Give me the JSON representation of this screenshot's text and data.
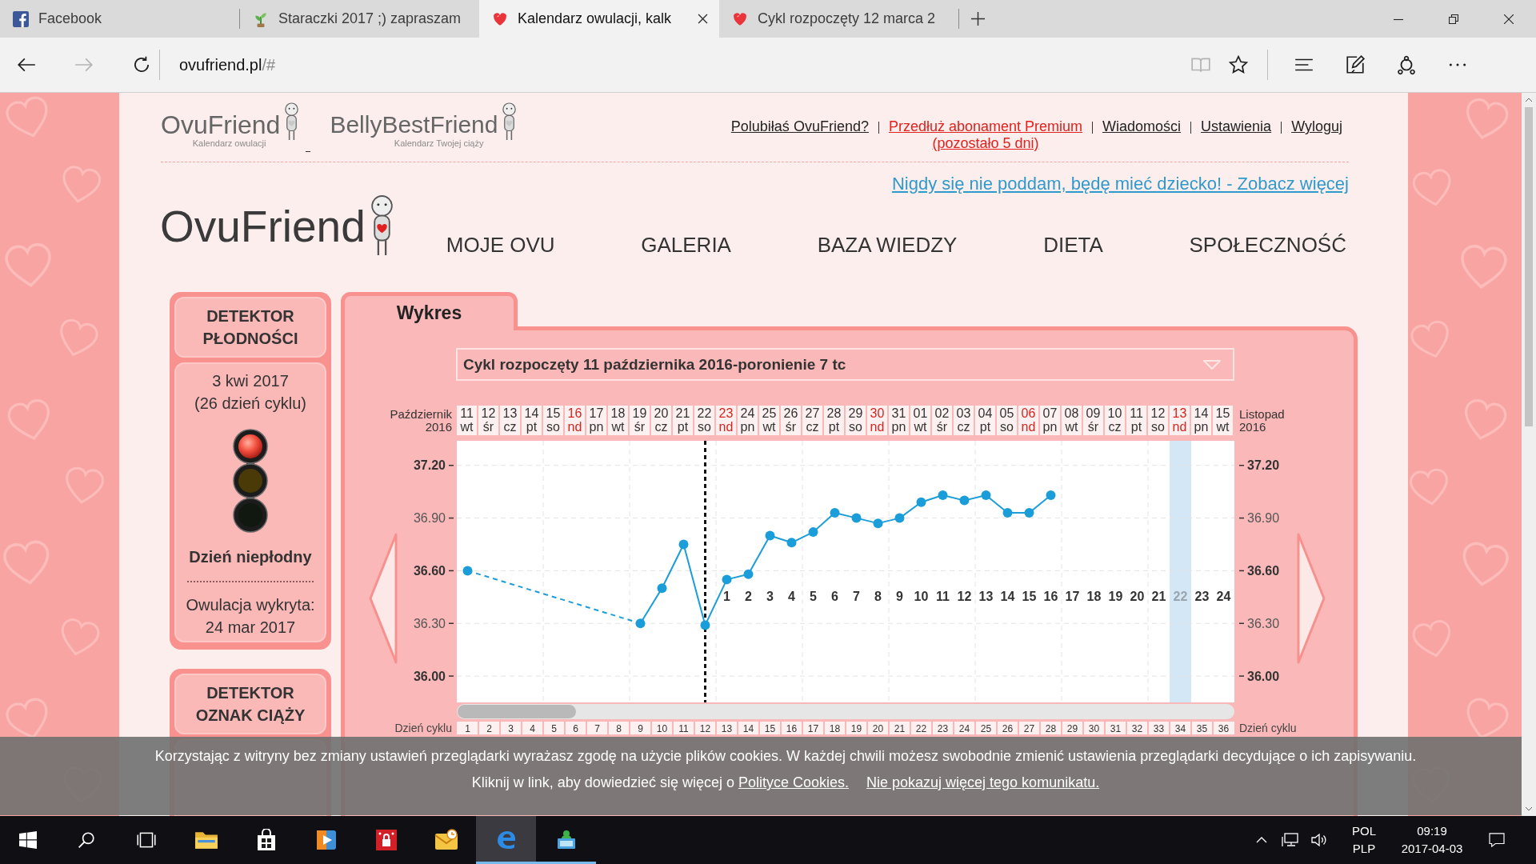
{
  "browser": {
    "tabs": [
      {
        "title": "Facebook",
        "kind": "social",
        "selected": false
      },
      {
        "title": "Staraczki 2017 ;) zapraszam",
        "kind": "plant",
        "selected": false
      },
      {
        "title": "Kalendarz owulacji, kalk",
        "kind": "heart",
        "selected": true
      },
      {
        "title": "Cykl rozpoczęty 12 marca 2",
        "kind": "heart",
        "selected": false
      }
    ],
    "nav_buttons": [
      {
        "kind": "back",
        "disabled": false
      },
      {
        "kind": "forward",
        "disabled": true
      },
      {
        "kind": "refresh",
        "disabled": false
      }
    ],
    "address": {
      "host": "ovufriend.pl",
      "path": "/#"
    },
    "tool_groups": [
      [
        {
          "kind": "reading_view",
          "disabled": true
        },
        {
          "kind": "favorite",
          "disabled": false
        }
      ],
      [
        {
          "kind": "hub",
          "disabled": false
        },
        {
          "kind": "note",
          "disabled": false
        },
        {
          "kind": "share",
          "disabled": false
        },
        {
          "kind": "more",
          "disabled": false
        }
      ]
    ]
  },
  "site": {
    "brand_logos": [
      {
        "name": "OvuFriend",
        "tagline": "Kalendarz owulacji"
      },
      {
        "name": "BellyBestFriend",
        "tagline": "Kalendarz Twojej ciąży"
      }
    ],
    "account_links": [
      {
        "label": "Polubiłaś OvuFriend?",
        "kind": "plain"
      },
      {
        "label": "Przedłuż abonament Premium",
        "note": "(pozostało 5 dni)",
        "kind": "alert"
      },
      {
        "label": "Wiadomości",
        "kind": "plain"
      },
      {
        "label": "Ustawienia",
        "kind": "plain"
      },
      {
        "label": "Wyloguj",
        "kind": "plain"
      }
    ],
    "promo_link": "Nigdy się nie poddam, będę mieć dziecko! - Zobacz więcej",
    "logo": "OvuFriend",
    "nav": [
      "MOJE OVU",
      "GALERIA",
      "BAZA WIEDZY",
      "DIETA",
      "SPOŁECZNOŚĆ"
    ]
  },
  "fertility_detector": {
    "title": "DETEKTOR PŁODNOŚCI",
    "date": "3 kwi 2017",
    "cycle_day": "(26 dzień cyklu)",
    "lamps": [
      {
        "kind": "red",
        "lit": true
      },
      {
        "kind": "yellow",
        "lit": false
      },
      {
        "kind": "green",
        "lit": false
      }
    ],
    "verdict": "Dzień niepłodny",
    "ovulation_label": "Owulacja wykryta:",
    "ovulation_date": "24 mar 2017"
  },
  "pregnancy_detector": {
    "title": "DETEKTOR OZNAK CIĄŻY"
  },
  "chart_panel": {
    "tabs": [
      {
        "label": "Wykres",
        "selected": true
      }
    ],
    "cycle_select": {
      "value": "Cykl rozpoczęty 11 października 2016-poronienie 7 tc"
    },
    "period_left": {
      "month": "Październik",
      "year": "2016"
    },
    "period_right": {
      "month": "Listopad",
      "year": "2016"
    },
    "right_axis": {
      "labels": [
        "37.20",
        "36.90",
        "36.60",
        "36.30",
        "36.00"
      ]
    },
    "days": [
      {
        "sunday": false,
        "cycle_day": "1"
      },
      {
        "sunday": false,
        "cycle_day": "2"
      },
      {
        "sunday": false,
        "cycle_day": "3"
      },
      {
        "sunday": false,
        "cycle_day": "4"
      },
      {
        "sunday": false,
        "cycle_day": "5"
      },
      {
        "sunday": true,
        "cycle_day": "6"
      },
      {
        "sunday": false,
        "cycle_day": "7"
      },
      {
        "sunday": false,
        "cycle_day": "8"
      },
      {
        "sunday": false,
        "cycle_day": "9"
      },
      {
        "sunday": false,
        "cycle_day": "10"
      },
      {
        "sunday": false,
        "cycle_day": "11"
      },
      {
        "sunday": false,
        "cycle_day": "12"
      },
      {
        "sunday": true,
        "cycle_day": "13",
        "count": "1"
      },
      {
        "sunday": false,
        "cycle_day": "14",
        "count": "2"
      },
      {
        "sunday": false,
        "cycle_day": "15",
        "count": "3"
      },
      {
        "sunday": false,
        "cycle_day": "16",
        "count": "4"
      },
      {
        "sunday": false,
        "cycle_day": "17",
        "count": "5"
      },
      {
        "sunday": false,
        "cycle_day": "18",
        "count": "6"
      },
      {
        "sunday": false,
        "cycle_day": "19",
        "count": "7"
      },
      {
        "sunday": true,
        "cycle_day": "20",
        "count": "8"
      },
      {
        "sunday": false,
        "cycle_day": "21",
        "count": "9"
      },
      {
        "sunday": false,
        "cycle_day": "22",
        "count": "10"
      },
      {
        "sunday": false,
        "cycle_day": "23",
        "count": "11"
      },
      {
        "sunday": false,
        "cycle_day": "24",
        "count": "12"
      },
      {
        "sunday": false,
        "cycle_day": "25",
        "count": "13"
      },
      {
        "sunday": false,
        "cycle_day": "26",
        "count": "14"
      },
      {
        "sunday": true,
        "cycle_day": "27",
        "count": "15"
      },
      {
        "sunday": false,
        "cycle_day": "28",
        "count": "16"
      },
      {
        "sunday": false,
        "cycle_day": "29",
        "count": "17"
      },
      {
        "sunday": false,
        "cycle_day": "30",
        "count": "18"
      },
      {
        "sunday": false,
        "cycle_day": "31",
        "count": "19"
      },
      {
        "sunday": false,
        "cycle_day": "32",
        "count": "20"
      },
      {
        "sunday": false,
        "cycle_day": "33",
        "count": "21"
      },
      {
        "sunday": true,
        "cycle_day": "34",
        "count": "22"
      },
      {
        "sunday": false,
        "cycle_day": "35",
        "count": "23"
      },
      {
        "sunday": false,
        "cycle_day": "36",
        "count": "24"
      }
    ],
    "cycle_row": {
      "left": "Dzień cyklu",
      "right": "Dzień cyklu"
    },
    "chart_data": {
      "type": "line",
      "categories": [
        "11 wt",
        "12 śr",
        "13 cz",
        "14 pt",
        "15 so",
        "16 nd",
        "17 pn",
        "18 wt",
        "19 śr",
        "20 cz",
        "21 pt",
        "22 so",
        "23 nd",
        "24 pn",
        "25 wt",
        "26 śr",
        "27 cz",
        "28 pt",
        "29 so",
        "30 nd",
        "31 pn",
        "01 wt",
        "02 śr",
        "03 cz",
        "04 pt",
        "05 so",
        "06 nd",
        "07 pn",
        "08 wt",
        "09 śr",
        "10 cz",
        "11 pt",
        "12 so",
        "13 nd",
        "14 pn",
        "15 wt"
      ],
      "series": [
        {
          "color": "#1b9dd9",
          "marker": "circle",
          "values": [
            36.6,
            null,
            null,
            null,
            null,
            null,
            null,
            null,
            36.3,
            36.5,
            36.75,
            36.29,
            36.55,
            36.58,
            36.8,
            36.76,
            36.82,
            36.93,
            36.9,
            36.87,
            36.9,
            36.99,
            37.03,
            37.0,
            37.03,
            36.93,
            36.93,
            37.03,
            null,
            null,
            null,
            null,
            null,
            null,
            null,
            null
          ]
        }
      ],
      "ylim": [
        35.85,
        37.34
      ],
      "yticks": [
        {
          "value": 36.0,
          "label": "36.00"
        },
        {
          "value": 36.3,
          "label": "36.30"
        },
        {
          "value": 36.6,
          "label": "36.60"
        },
        {
          "value": 36.9,
          "label": "36.90"
        },
        {
          "value": 37.2,
          "label": "37.20"
        }
      ],
      "grid": true,
      "ref_lines": [
        {
          "axis": "x",
          "value": "22 so"
        }
      ],
      "bands": [
        {
          "axis": "x",
          "from": "13 nd",
          "to": "13 nd"
        }
      ]
    }
  },
  "cookie_notice": {
    "text": "Korzystając z witryny bez zmiany ustawień przeglądarki wyrażasz zgodę na użycie plików cookies. W każdej chwili możesz swobodnie zmienić ustawienia przeglądarki decydujące o ich zapisywaniu.",
    "info": "Kliknij w link, aby dowiedzieć się więcej o",
    "policy_link": "Polityce Cookies.",
    "dismiss_link": "Nie pokazuj więcej tego komunikatu."
  },
  "taskbar": {
    "apps": [
      {
        "kind": "folder",
        "running": false,
        "selected": false
      },
      {
        "kind": "store",
        "running": false,
        "selected": false
      },
      {
        "kind": "media",
        "running": false,
        "selected": false
      },
      {
        "kind": "security",
        "running": false,
        "selected": false
      },
      {
        "kind": "mail",
        "running": false,
        "selected": false
      },
      {
        "kind": "browser",
        "running": true,
        "selected": true
      },
      {
        "kind": "computer",
        "running": true,
        "selected": false
      }
    ],
    "language": {
      "code": "POL",
      "layout": "PLP"
    },
    "clock": {
      "time": "09:19",
      "date": "2017-04-03"
    }
  }
}
